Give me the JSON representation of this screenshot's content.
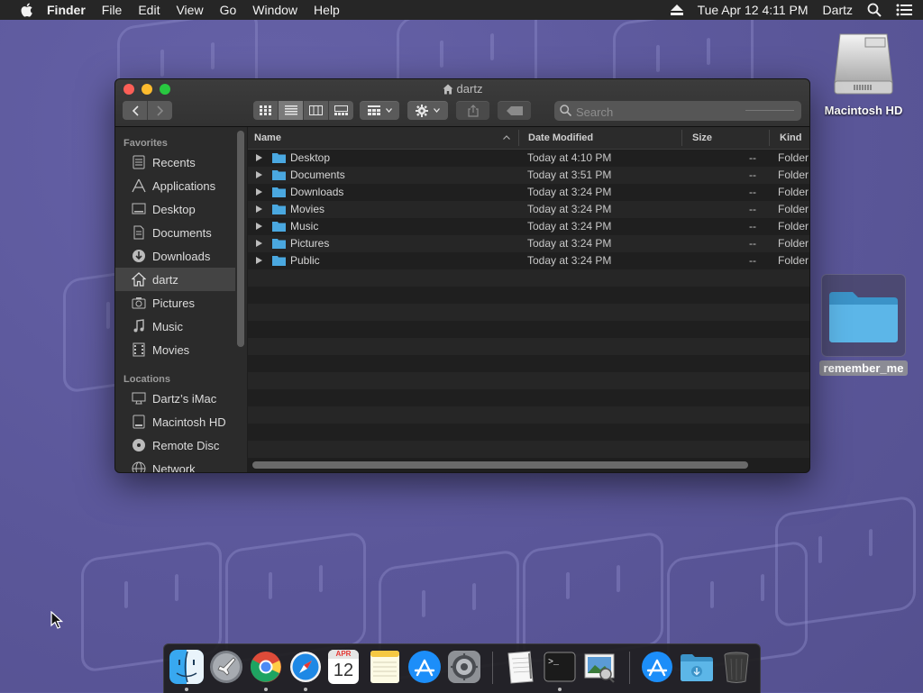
{
  "menubar": {
    "app": "Finder",
    "items": [
      "File",
      "Edit",
      "View",
      "Go",
      "Window",
      "Help"
    ],
    "datetime": "Tue Apr 12  4:11 PM",
    "user": "Dartz"
  },
  "desktop": {
    "hd_label": "Macintosh HD",
    "folder_label": "remember_me"
  },
  "window": {
    "title": "dartz",
    "search_placeholder": "Search",
    "sidebar": {
      "favorites_heading": "Favorites",
      "favorites": [
        {
          "label": "Recents",
          "icon": "recents-icon"
        },
        {
          "label": "Applications",
          "icon": "applications-icon"
        },
        {
          "label": "Desktop",
          "icon": "desktop-icon"
        },
        {
          "label": "Documents",
          "icon": "documents-icon"
        },
        {
          "label": "Downloads",
          "icon": "downloads-icon"
        },
        {
          "label": "dartz",
          "icon": "home-icon",
          "selected": true
        },
        {
          "label": "Pictures",
          "icon": "pictures-icon"
        },
        {
          "label": "Music",
          "icon": "music-icon"
        },
        {
          "label": "Movies",
          "icon": "movies-icon"
        }
      ],
      "locations_heading": "Locations",
      "locations": [
        {
          "label": "Dartz’s iMac",
          "icon": "imac-icon"
        },
        {
          "label": "Macintosh HD",
          "icon": "hard-drive-icon"
        },
        {
          "label": "Remote Disc",
          "icon": "remote-disc-icon"
        },
        {
          "label": "Network",
          "icon": "network-icon"
        }
      ]
    },
    "columns": {
      "name": "Name",
      "date": "Date Modified",
      "size": "Size",
      "kind": "Kind"
    },
    "rows": [
      {
        "name": "Desktop",
        "date": "Today at 4:10 PM",
        "size": "--",
        "kind": "Folder"
      },
      {
        "name": "Documents",
        "date": "Today at 3:51 PM",
        "size": "--",
        "kind": "Folder"
      },
      {
        "name": "Downloads",
        "date": "Today at 3:24 PM",
        "size": "--",
        "kind": "Folder"
      },
      {
        "name": "Movies",
        "date": "Today at 3:24 PM",
        "size": "--",
        "kind": "Folder"
      },
      {
        "name": "Music",
        "date": "Today at 3:24 PM",
        "size": "--",
        "kind": "Folder"
      },
      {
        "name": "Pictures",
        "date": "Today at 3:24 PM",
        "size": "--",
        "kind": "Folder"
      },
      {
        "name": "Public",
        "date": "Today at 3:24 PM",
        "size": "--",
        "kind": "Folder"
      }
    ]
  },
  "dock": {
    "calendar_month": "APR",
    "calendar_day": "12"
  },
  "colors": {
    "desktop_bg": "#5d5a9c",
    "folder_blue": "#4aa8e0",
    "window_bg": "#1e1e1e"
  }
}
